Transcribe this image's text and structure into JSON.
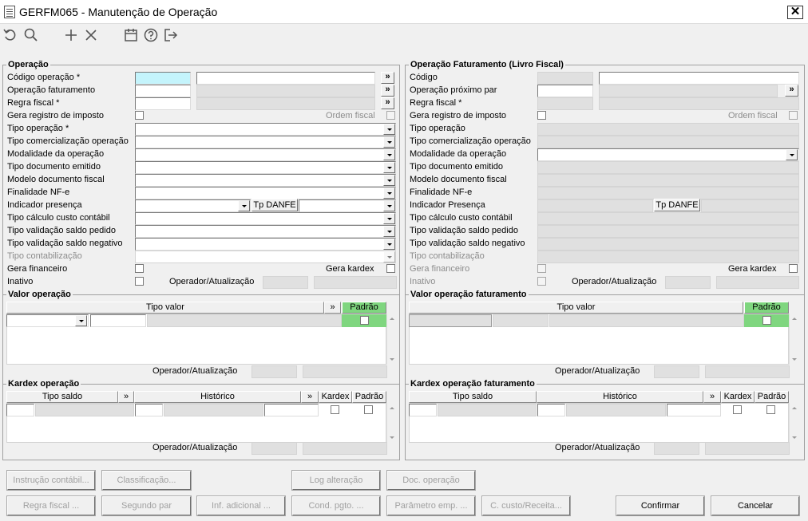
{
  "window": {
    "title": "GERFM065 - Manutenção de Operação",
    "close": "✕"
  },
  "toolbar": {
    "icons": [
      "undo-icon",
      "search-icon",
      "add-icon",
      "delete-icon",
      "calendar-icon",
      "help-icon",
      "exit-icon"
    ]
  },
  "left": {
    "title": "Operação",
    "labels": {
      "codigo": "Código operação *",
      "op_fat": "Operação faturamento",
      "regra": "Regra fiscal *",
      "gera_reg": "Gera registro de imposto",
      "ordem": "Ordem fiscal",
      "tipo_op": "Tipo operação *",
      "tipo_com": "Tipo comercialização operação",
      "modalidade": "Modalidade da operação",
      "tipo_doc": "Tipo documento emitido",
      "modelo": "Modelo documento fiscal",
      "finalidade": "Finalidade NF-e",
      "indicador": "Indicador presença",
      "tp_danfe": "Tp DANFE",
      "calc_custo": "Tipo cálculo custo contábil",
      "val_pedido": "Tipo validação saldo pedido",
      "val_negativo": "Tipo validação saldo negativo",
      "contab": "Tipo contabilização",
      "gera_fin": "Gera financeiro",
      "gera_kardex": "Gera kardex",
      "inativo": "Inativo",
      "operador": "Operador/Atualização"
    },
    "valor_title": "Valor operação",
    "valor_cols": {
      "tipo": "Tipo valor",
      "more": "»",
      "padrao": "Padrão"
    },
    "kardex_title": "Kardex operação",
    "kardex_cols": {
      "saldo": "Tipo saldo",
      "more1": "»",
      "hist": "Histórico",
      "more2": "»",
      "kardex": "Kardex",
      "padrao": "Padrão"
    }
  },
  "right": {
    "title": "Operação Faturamento (Livro Fiscal)",
    "labels": {
      "codigo": "Código",
      "prox_par": "Operação próximo par",
      "regra": "Regra fiscal *",
      "gera_reg": "Gera registro de imposto",
      "ordem": "Ordem fiscal",
      "tipo_op": "Tipo operação",
      "tipo_com": "Tipo comercialização operação",
      "modalidade": "Modalidade da operação",
      "tipo_doc": "Tipo documento emitido",
      "modelo": "Modelo documento fiscal",
      "finalidade": "Finalidade NF-e",
      "indicador": "Indicador Presença",
      "tp_danfe": "Tp DANFE",
      "calc_custo": "Tipo cálculo custo contábil",
      "val_pedido": "Tipo validação saldo pedido",
      "val_negativo": "Tipo validação saldo negativo",
      "contab": "Tipo contabilização",
      "gera_fin": "Gera financeiro",
      "gera_kardex": "Gera kardex",
      "inativo": "Inativo",
      "operador": "Operador/Atualização"
    },
    "valor_title": "Valor operação faturamento",
    "valor_cols": {
      "tipo": "Tipo valor",
      "padrao": "Padrão"
    },
    "kardex_title": "Kardex operação faturamento",
    "kardex_cols": {
      "saldo": "Tipo saldo",
      "hist": "Histórico",
      "more": "»",
      "kardex": "Kardex",
      "padrao": "Padrão"
    }
  },
  "more": "»",
  "buttons": {
    "instrucao": "Instrução contábil...",
    "classificacao": "Classificação...",
    "log": "Log alteração",
    "doc": "Doc. operação",
    "regra": "Regra fiscal ...",
    "segundo": "Segundo par",
    "inf": "Inf. adicional ...",
    "cond": "Cond. pgto. ...",
    "parametro": "Parâmetro emp. ...",
    "custo": "C. custo/Receita...",
    "confirmar": "Confirmar",
    "cancelar": "Cancelar"
  }
}
